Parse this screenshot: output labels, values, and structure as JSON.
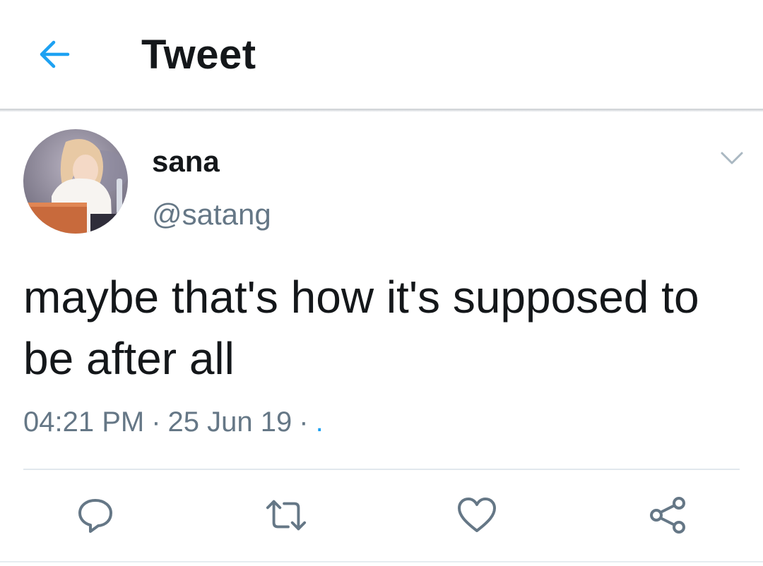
{
  "header": {
    "title": "Tweet",
    "back_icon": "arrow-left-icon"
  },
  "tweet": {
    "author": {
      "display_name": "sana",
      "handle": "@satang"
    },
    "text": "maybe that's how it's supposed to be after all",
    "time": "04:21 PM",
    "date": "25 Jun 19",
    "separator": "·",
    "source": "."
  },
  "actions": [
    {
      "icon": "reply-icon"
    },
    {
      "icon": "retweet-icon"
    },
    {
      "icon": "like-icon"
    },
    {
      "icon": "share-icon"
    }
  ],
  "colors": {
    "accent": "#1da1f2",
    "text": "#14171a",
    "secondary": "#657786",
    "divider": "#e1e8ed"
  }
}
